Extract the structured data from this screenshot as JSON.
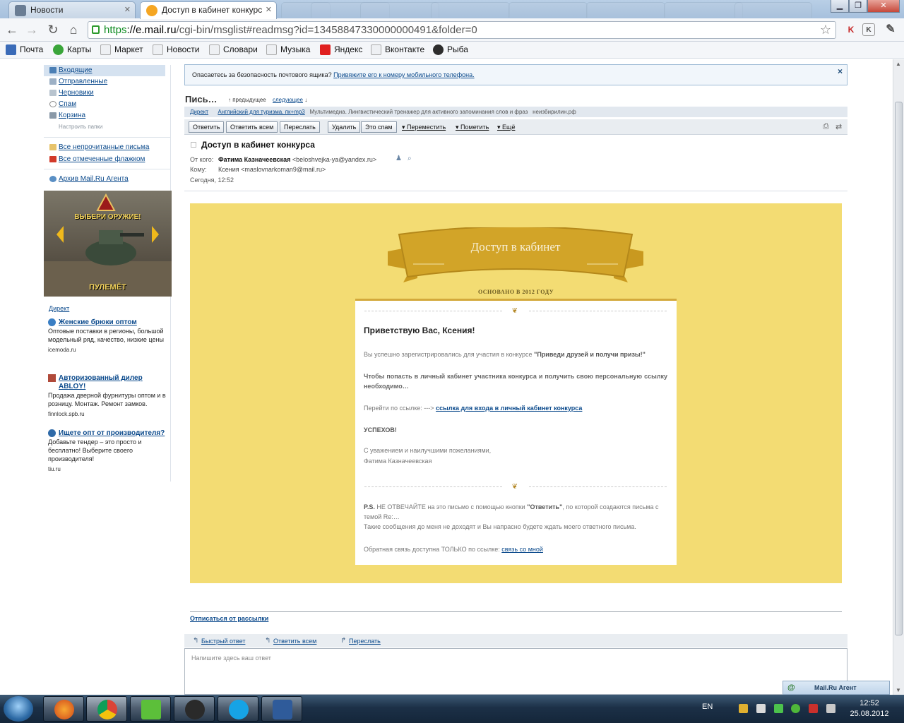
{
  "browser": {
    "tabs": [
      {
        "title": "Новости"
      },
      {
        "title": "Доступ в кабинет конкурс"
      }
    ],
    "url_scheme": "https",
    "url_host": "://e.mail.ru",
    "url_path": "/cgi-bin/msglist#readmsg?id=13458847330000000491&folder=0",
    "bookmarks": [
      "Почта",
      "Карты",
      "Маркет",
      "Новости",
      "Словари",
      "Музыка",
      "Яндекс",
      "Вконтакте",
      "Рыба"
    ]
  },
  "sidebar": {
    "folders": [
      "Входящие",
      "Отправленные",
      "Черновики",
      "Спам",
      "Корзина"
    ],
    "setup_folders": "Настроить папки",
    "unread": "Все непрочитанные письма",
    "flagged": "Все отмеченные флажком",
    "agent_archive": "Архив Mail.Ru Агента",
    "banner_top": "ВЫБЕРИ ОРУЖИЕ!",
    "banner_bottom": "ПУЛЕМЁТ",
    "direct": "Директ",
    "ads": [
      {
        "title": "Женские брюки оптом",
        "text": "Оптовые поставки в регионы, большой модельный ряд, качество, низкие цены",
        "domain": "icemoda.ru"
      },
      {
        "title": "Авторизованный дилер ABLOY!",
        "text": "Продажа дверной фурнитуры оптом и в розницу. Монтаж. Ремонт замков.",
        "domain": "finnlock.spb.ru"
      },
      {
        "title": "Ищете опт от производителя?",
        "text": "Добавьте тендер – это просто и бесплатно! Выберите своего производителя!",
        "domain": "tiu.ru"
      }
    ]
  },
  "main": {
    "info_text": "Опасаетесь за безопасность почтового ящика?",
    "info_link": "Привяжите его к номеру мобильного телефона.",
    "info_close": "×",
    "title": "Пись…",
    "prev": "↑ предыдущее",
    "next": "следующее",
    "next_arrow": "↓",
    "direct_label": "Директ",
    "direct_link": "Английский для туризма. пк+mp3",
    "direct_text": "Мультимедиа. Лингвистический тренажер для активного запоминания слов и фраз",
    "direct_domain": "неизбирилин.рф",
    "buttons": {
      "reply": "Ответить",
      "reply_all": "Ответить всем",
      "forward": "Переслать",
      "delete": "Удалить",
      "spam": "Это спам",
      "move": "Переместить",
      "mark": "Пометить",
      "more": "Ещё"
    },
    "subject": "Доступ в кабинет конкурса",
    "from_label": "От кого:",
    "from_name": "Фатима Казначеевская",
    "from_email": "<beloshvejka-ya@yandex.ru>",
    "to_label": "Кому:",
    "to_value": "Ксения <maslovnarkoman9@mail.ru>",
    "date": "Сегодня, 12:52"
  },
  "letter": {
    "ribbon": "Доступ в кабинет",
    "established": "ОСНОВАНО В 2012 ГОДУ",
    "greeting": "Приветствую Вас, Ксения!",
    "p1_pre": "Вы успешно зарегистрировались для участия в конкурсе ",
    "p1_bold": "\"Приведи друзей и получи призы!\"",
    "p2": "Чтобы попасть в личный кабинет участника конкурса и получить свою персональную ссылку необходимо…",
    "p3_pre": "Перейти по ссылке: --->",
    "p3_link": "ссылка для входа в личный кабинет конкурса",
    "p4": "УСПЕХОВ!",
    "p5a": "С уважением и наилучшими пожеланиями,",
    "p5b": "Фатима Казначеевская",
    "ps_bold": "P.S.",
    "ps_1": "НЕ ОТВЕЧАЙТЕ на это письмо с помощью кнопки",
    "ps_btn": "\"Ответить\"",
    "ps_2": ", по которой создаются письма с темой Re:…",
    "ps_3": "Такие сообщения до меня не доходят и Вы напрасно будете ждать моего ответного письма.",
    "fb_pre": "Обратная связь доступна ТОЛЬКО по ссылке:",
    "fb_link": "связь со мной"
  },
  "footer": {
    "unsubscribe": "Отписаться от рассылки",
    "quick_reply": "Быстрый ответ",
    "reply_all": "Ответить всем",
    "forward": "Переслать",
    "reply_placeholder": "Напишите здесь ваш ответ",
    "agent": "Mail.Ru Агент"
  },
  "taskbar": {
    "lang": "EN",
    "time": "12:52",
    "date": "25.08.2012"
  }
}
